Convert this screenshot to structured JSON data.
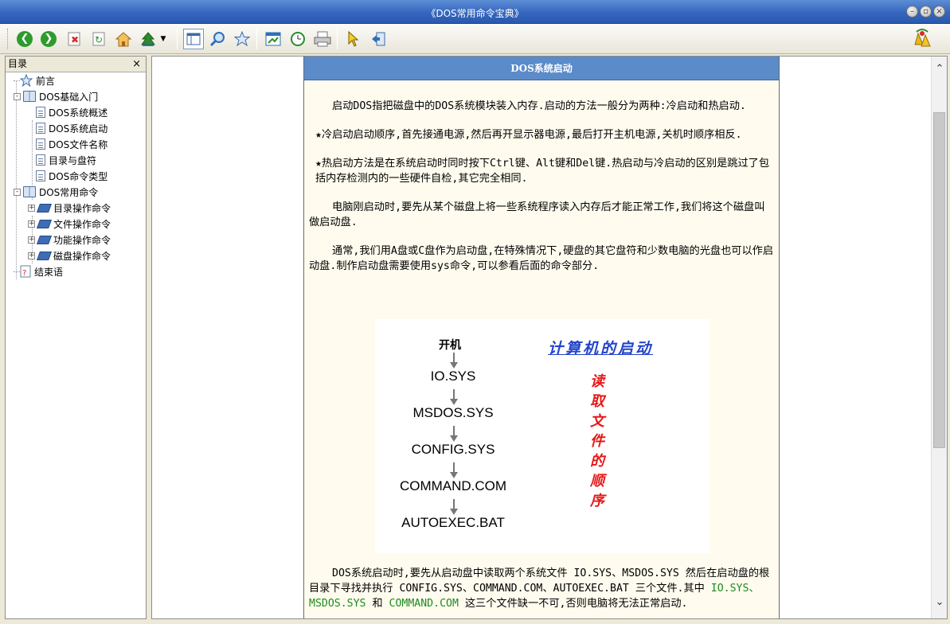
{
  "window": {
    "title": "《DOS常用命令宝典》",
    "buttons": [
      "minimize",
      "restore",
      "close"
    ]
  },
  "toolbar": {
    "buttons": [
      {
        "name": "back",
        "icon": "arrow-left-icon",
        "color": "#2e9b2e"
      },
      {
        "name": "forward",
        "icon": "arrow-right-icon",
        "color": "#2e9b2e"
      },
      {
        "name": "stop",
        "icon": "stop-icon",
        "color": "#d62b2b"
      },
      {
        "name": "refresh",
        "icon": "refresh-icon",
        "color": "#2e8b2e"
      },
      {
        "name": "home",
        "icon": "home-icon",
        "color": "#d28a2a"
      },
      {
        "name": "locate",
        "icon": "tree-icon",
        "color": "#2f6fb8"
      },
      {
        "name": "hide-pane",
        "icon": "pane-icon",
        "color": "#3c6aa6"
      },
      {
        "name": "search",
        "icon": "magnifier-icon",
        "color": "#2f6fb8"
      },
      {
        "name": "favorites",
        "icon": "star-icon",
        "color": "#3c6aa6"
      },
      {
        "name": "options",
        "icon": "window-icon",
        "color": "#2f6fb8"
      },
      {
        "name": "history",
        "icon": "clock-icon",
        "color": "#2e8b2e"
      },
      {
        "name": "print",
        "icon": "printer-icon",
        "color": "#666666"
      },
      {
        "name": "pointer",
        "icon": "cursor-icon",
        "color": "#d8a800"
      },
      {
        "name": "exit",
        "icon": "exit-icon",
        "color": "#3c6aa6"
      }
    ]
  },
  "sidebar": {
    "header": "目录",
    "close": "×",
    "tree": [
      {
        "label": "前言",
        "level": 0,
        "icon": "star-icon"
      },
      {
        "label": "DOS基础入门",
        "level": 0,
        "icon": "open-book-icon",
        "expander": "-"
      },
      {
        "label": "DOS系统概述",
        "level": 1,
        "icon": "page-icon"
      },
      {
        "label": "DOS系统启动",
        "level": 1,
        "icon": "page-icon"
      },
      {
        "label": "DOS文件名称",
        "level": 1,
        "icon": "page-icon"
      },
      {
        "label": "目录与盘符",
        "level": 1,
        "icon": "page-icon"
      },
      {
        "label": "DOS命令类型",
        "level": 1,
        "icon": "page-icon"
      },
      {
        "label": "DOS常用命令",
        "level": 0,
        "icon": "open-book-icon",
        "expander": "-"
      },
      {
        "label": "目录操作命令",
        "level": 1,
        "icon": "book-icon",
        "expander": "+"
      },
      {
        "label": "文件操作命令",
        "level": 1,
        "icon": "book-icon",
        "expander": "+"
      },
      {
        "label": "功能操作命令",
        "level": 1,
        "icon": "book-icon",
        "expander": "+"
      },
      {
        "label": "磁盘操作命令",
        "level": 1,
        "icon": "book-icon",
        "expander": "+"
      },
      {
        "label": "结束语",
        "level": 0,
        "icon": "help-page-icon"
      }
    ]
  },
  "article": {
    "heading": "DOS系统启动",
    "p1": "启动DOS指把磁盘中的DOS系统模块装入内存.启动的方法一般分为两种:冷启动和热启动.",
    "p2": "★冷启动启动顺序,首先接通电源,然后再开显示器电源,最后打开主机电源,关机时顺序相反.",
    "p3": "★热启动方法是在系统启动时同时按下Ctrl键、Alt键和Del键.热启动与冷启动的区别是跳过了包括内存检测内的一些硬件自检,其它完全相同.",
    "p4": "电脑刚启动时,要先从某个磁盘上将一些系统程序读入内存后才能正常工作,我们将这个磁盘叫做启动盘.",
    "p5": "通常,我们用A盘或C盘作为启动盘,在特殊情况下,硬盘的其它盘符和少数电脑的光盘也可以作启动盘.制作启动盘需要使用sys命令,可以参看后面的命令部分.",
    "p6_a": "DOS系统启动时,要先从启动盘中读取两个系统文件 IO.SYS、MSDOS.SYS 然后在启动盘的根目录下寻找并执行 CONFIG.SYS、COMMAND.COM、AUTOEXEC.BAT 三个文件.其中 ",
    "p6_green1": "IO.SYS、MSDOS.SYS",
    "p6_b": " 和 ",
    "p6_green2": "COMMAND.COM",
    "p6_c": " 这三个文件缺一不可,否则电脑将无法正常启动."
  },
  "diagram": {
    "start": "开机",
    "steps": [
      "IO.SYS",
      "MSDOS.SYS",
      "CONFIG.SYS",
      "COMMAND.COM",
      "AUTOEXEC.BAT"
    ],
    "title": "计算机的启动",
    "vertical": [
      "读",
      "取",
      "文",
      "件",
      "的",
      "顺",
      "序"
    ]
  },
  "scrollbar": {
    "up": "⌃",
    "down": "⌄"
  }
}
